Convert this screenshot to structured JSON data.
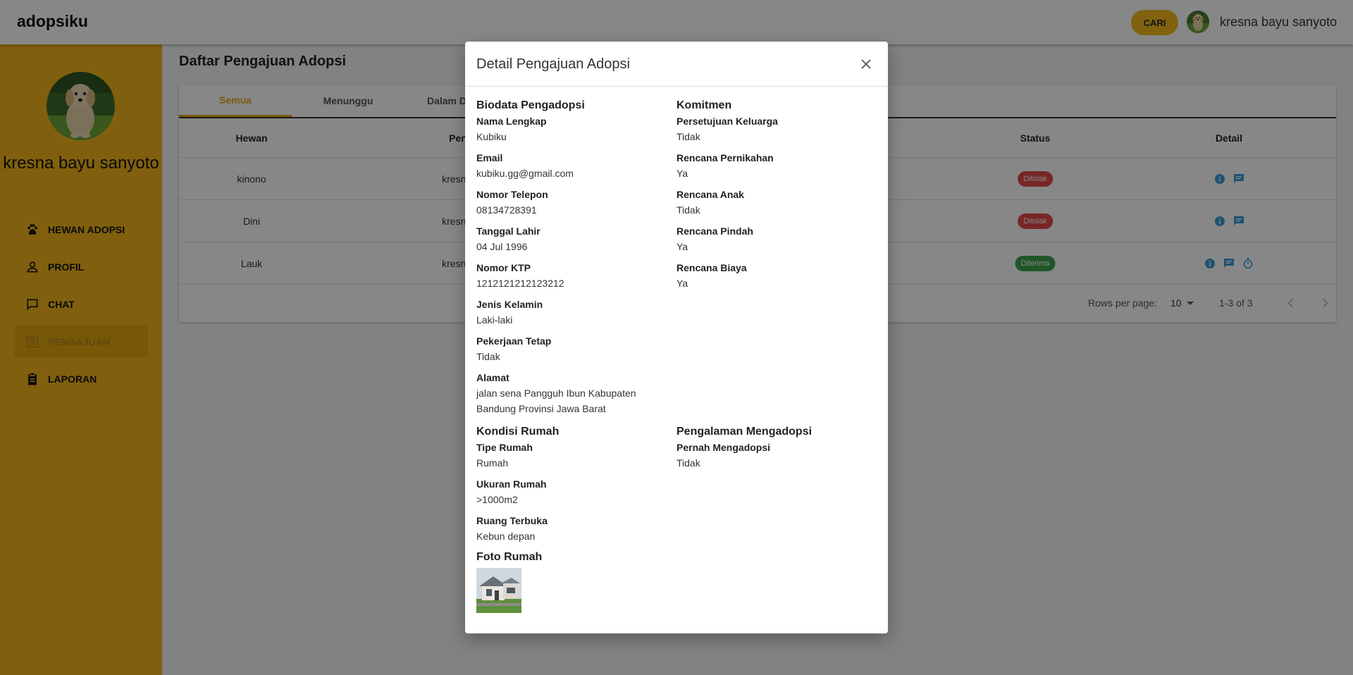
{
  "app": {
    "brand": "adopsiku"
  },
  "header": {
    "search_label": "CARI",
    "username": "kresna bayu sanyoto",
    "avatar_icon": "dog-avatar"
  },
  "sidebar": {
    "name": "kresna bayu sanyoto",
    "items": [
      {
        "label": "HEWAN ADOPSI",
        "icon": "paw-icon",
        "active": false
      },
      {
        "label": "PROFIL",
        "icon": "person-icon",
        "active": false
      },
      {
        "label": "CHAT",
        "icon": "chat-icon",
        "active": false
      },
      {
        "label": "PENGAJUAN",
        "icon": "list-icon",
        "active": true
      },
      {
        "label": "LAPORAN",
        "icon": "clipboard-icon",
        "active": false
      }
    ]
  },
  "main": {
    "title": "Daftar Pengajuan Adopsi",
    "tabs": [
      "Semua",
      "Menunggu",
      "Dalam D"
    ],
    "columns": {
      "hewan": "Hewan",
      "pengaju": "Pen",
      "status": "Status",
      "detail": "Detail"
    },
    "rows": [
      {
        "hewan": "kinono",
        "pengaju": "kresna b",
        "status": "Ditolak",
        "status_color": "#e04848"
      },
      {
        "hewan": "Dini",
        "pengaju": "kresna b",
        "status": "Ditolak",
        "status_color": "#e04848"
      },
      {
        "hewan": "Lauk",
        "pengaju": "kresna b",
        "status": "Diterima",
        "status_color": "#3fa34d"
      }
    ],
    "pagination": {
      "rows_per_page_label": "Rows per page:",
      "rows_per_page": "10",
      "range": "1-3 of 3"
    }
  },
  "modal": {
    "title": "Detail Pengajuan Adopsi",
    "biodata": {
      "title": "Biodata Pengadopsi",
      "fields": [
        {
          "label": "Nama Lengkap",
          "value": "Kubiku"
        },
        {
          "label": "Email",
          "value": "kubiku.gg@gmail.com"
        },
        {
          "label": "Nomor Telepon",
          "value": "08134728391"
        },
        {
          "label": "Tanggal Lahir",
          "value": "04 Jul 1996"
        },
        {
          "label": "Nomor KTP",
          "value": "1212121212123212"
        },
        {
          "label": "Jenis Kelamin",
          "value": "Laki-laki"
        },
        {
          "label": "Pekerjaan Tetap",
          "value": "Tidak"
        },
        {
          "label": "Alamat",
          "value": "jalan sena Pangguh Ibun Kabupaten Bandung Provinsi Jawa Barat"
        }
      ]
    },
    "komitmen": {
      "title": "Komitmen",
      "fields": [
        {
          "label": "Persetujuan Keluarga",
          "value": "Tidak"
        },
        {
          "label": "Rencana Pernikahan",
          "value": "Ya"
        },
        {
          "label": "Rencana Anak",
          "value": "Tidak"
        },
        {
          "label": "Rencana Pindah",
          "value": "Ya"
        },
        {
          "label": "Rencana Biaya",
          "value": "Ya"
        }
      ]
    },
    "kondisi": {
      "title": "Kondisi Rumah",
      "fields": [
        {
          "label": "Tipe Rumah",
          "value": "Rumah"
        },
        {
          "label": "Ukuran Rumah",
          "value": ">1000m2"
        },
        {
          "label": "Ruang Terbuka",
          "value": "Kebun depan"
        }
      ]
    },
    "pengalaman": {
      "title": "Pengalaman Mengadopsi",
      "fields": [
        {
          "label": "Pernah Mengadopsi",
          "value": "Tidak"
        }
      ]
    },
    "foto": {
      "title": "Foto Rumah"
    }
  }
}
